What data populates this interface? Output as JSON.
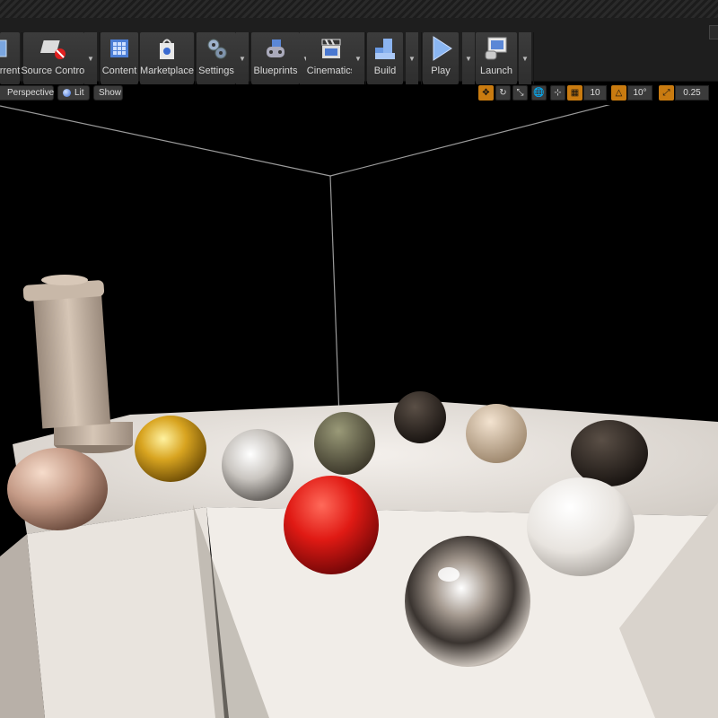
{
  "toolbar": {
    "buttons": [
      {
        "label": "rrent",
        "icon": "browse-icon"
      },
      {
        "label": "Source Control",
        "icon": "source-control-icon"
      },
      {
        "label": "Content",
        "icon": "content-icon"
      },
      {
        "label": "Marketplace",
        "icon": "marketplace-icon"
      },
      {
        "label": "Settings",
        "icon": "settings-icon"
      },
      {
        "label": "Blueprints",
        "icon": "blueprints-icon"
      },
      {
        "label": "Cinematics",
        "icon": "cinematics-icon"
      },
      {
        "label": "Build",
        "icon": "build-icon"
      },
      {
        "label": "Play",
        "icon": "play-icon"
      },
      {
        "label": "Launch",
        "icon": "launch-icon"
      }
    ]
  },
  "viewport": {
    "view_mode": "Perspective",
    "lighting_mode": "Lit",
    "show_label": "Show",
    "grid_snap": "10",
    "rotation_snap": "10°",
    "scale_snap": "0.25"
  },
  "colors": {
    "accent": "#c97b10",
    "toolbar_bg": "#1e1e1e",
    "viewport_bg": "#000000"
  }
}
